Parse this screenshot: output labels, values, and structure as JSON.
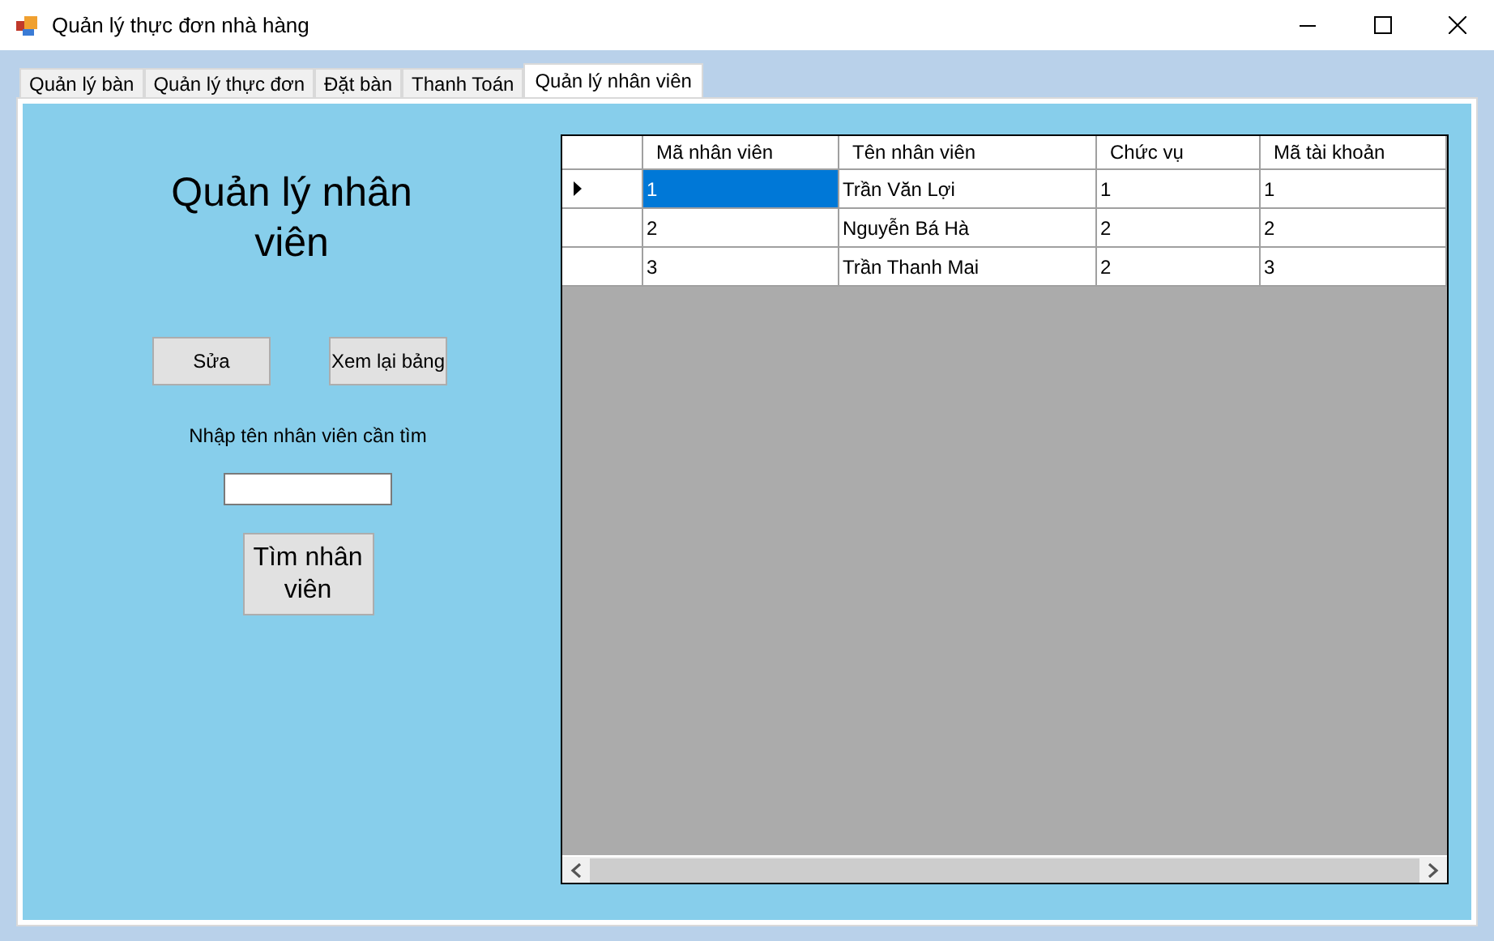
{
  "window": {
    "title": "Quản lý thực đơn nhà hàng"
  },
  "tabs": [
    {
      "label": "Quản lý bàn",
      "selected": false
    },
    {
      "label": "Quản lý thực đơn",
      "selected": false
    },
    {
      "label": "Đặt bàn",
      "selected": false
    },
    {
      "label": "Thanh Toán",
      "selected": false
    },
    {
      "label": "Quản lý nhân viên",
      "selected": true
    }
  ],
  "form": {
    "title": "Quản lý nhân viên",
    "edit_button": "Sửa",
    "reload_button": "Xem lại bảng",
    "search_label": "Nhập tên nhân viên cần tìm",
    "search_button": "Tìm nhân viên"
  },
  "table": {
    "columns": [
      "Mã nhân viên",
      "Tên nhân viên",
      "Chức vụ",
      "Mã tài khoản"
    ],
    "rows": [
      {
        "cells": [
          "1",
          "Trần Văn Lợi",
          "1",
          "1"
        ],
        "selected": true
      },
      {
        "cells": [
          "2",
          "Nguyễn Bá Hà",
          "2",
          "2"
        ],
        "selected": false
      },
      {
        "cells": [
          "3",
          "Trần Thanh Mai",
          "2",
          "3"
        ],
        "selected": false
      }
    ]
  }
}
